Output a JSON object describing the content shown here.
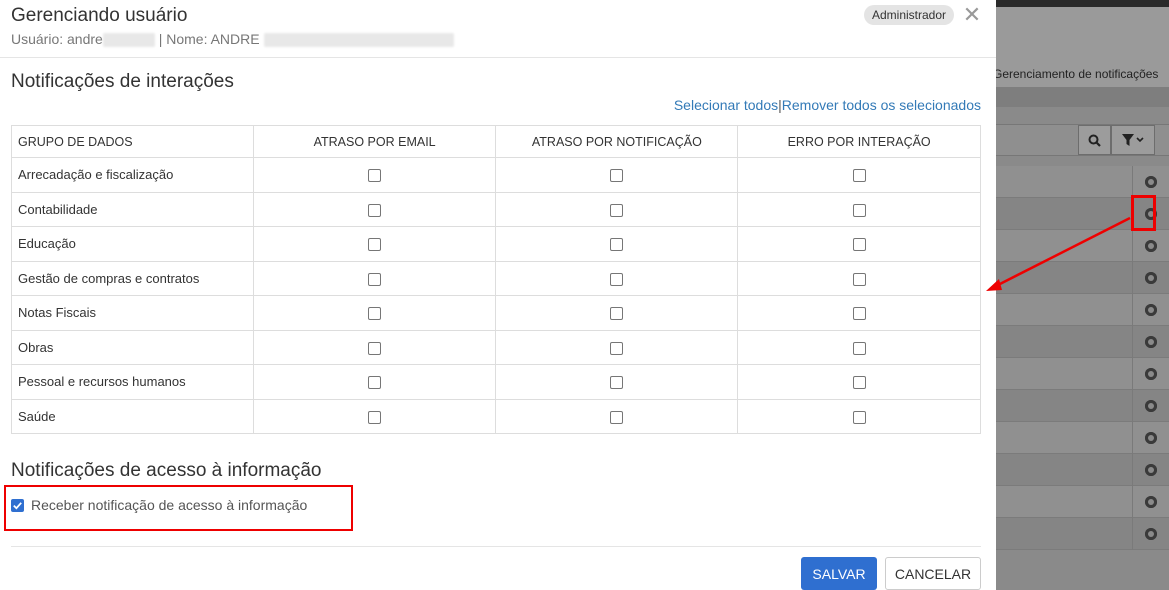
{
  "modal": {
    "title": "Gerenciando usuário",
    "subtitle_user_prefix": "Usuário: andre",
    "subtitle_name_prefix": "| Nome: ANDRE",
    "badge": "Administrador",
    "close_label": "✕"
  },
  "interactions": {
    "title": "Notificações de interações",
    "select_all": "Selecionar todos",
    "separator": "|",
    "remove_all": "Remover todos os selecionados",
    "columns": [
      "GRUPO DE DADOS",
      "ATRASO POR EMAIL",
      "ATRASO POR NOTIFICAÇÃO",
      "ERRO POR INTERAÇÃO"
    ],
    "rows": [
      "Arrecadação e fiscalização",
      "Contabilidade",
      "Educação",
      "Gestão de compras e contratos",
      "Notas Fiscais",
      "Obras",
      "Pessoal e recursos humanos",
      "Saúde"
    ]
  },
  "access": {
    "title": "Notificações de acesso à informação",
    "checkbox_label": "Receber notificação de acesso à informação",
    "checked": true
  },
  "footer": {
    "save": "SALVAR",
    "cancel": "CANCELAR"
  },
  "background": {
    "breadcrumb": "Gerenciamento de notificações",
    "search_icon": "search-icon",
    "filter_icon": "filter-icon",
    "gear_icon": "gear-icon"
  },
  "colors": {
    "primary": "#2f6fd0",
    "link": "#337ab7",
    "highlight": "#e00000"
  }
}
